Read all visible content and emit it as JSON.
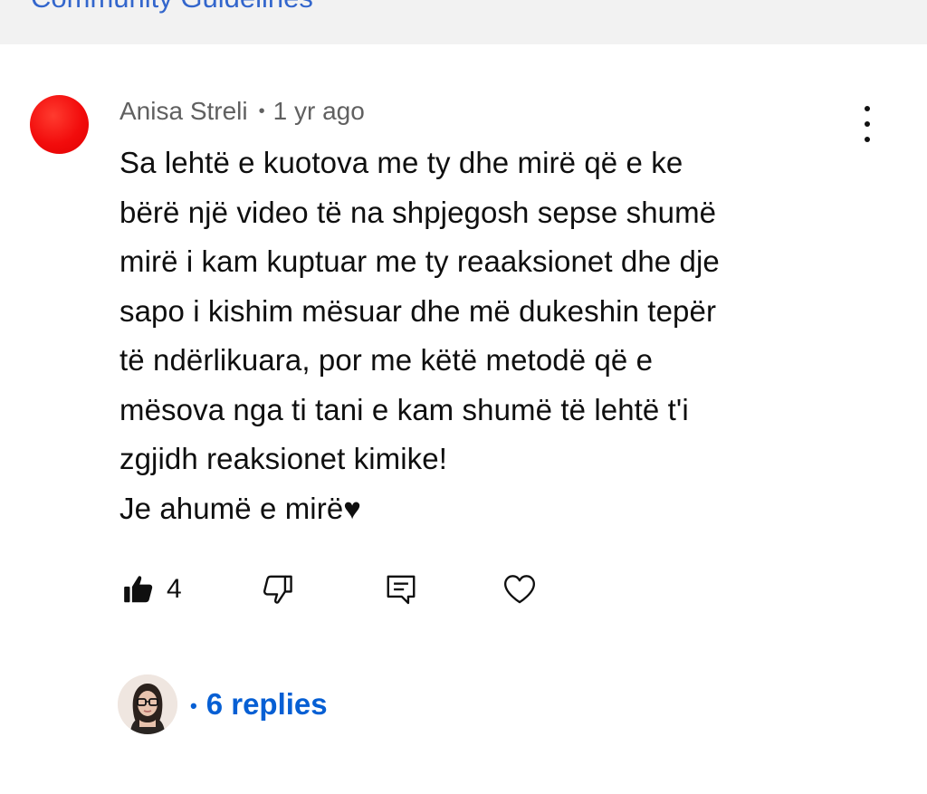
{
  "banner": {
    "link_label": "Community Guidelines"
  },
  "comment": {
    "author": "Anisa Streli",
    "separator": "•",
    "time": "1 yr ago",
    "text_lines": [
      "Sa lehtë e kuotova me ty dhe mirë që e ke",
      "bërë një video të na shpjegosh sepse shumë",
      "mirë i kam kuptuar me ty reaaksionet dhe dje",
      "sapo i kishim mësuar dhe më dukeshin tepër",
      "të ndërlikuara, por me këtë metodë që e",
      "mësova nga ti tani e kam shumë të lehtë t'i",
      "zgjidh reaksionet kimike!",
      "Je ahumë e mirë♥"
    ],
    "like_count": "4",
    "avatar_color": "#f20c0c"
  },
  "replies": {
    "separator": "•",
    "label": "6 replies",
    "color": "#065fd4"
  },
  "icons": {
    "like": "thumbs-up-filled-icon",
    "dislike": "thumbs-down-outline-icon",
    "reply": "comment-reply-icon",
    "heart": "heart-outline-icon",
    "menu": "more-vertical-icon"
  }
}
